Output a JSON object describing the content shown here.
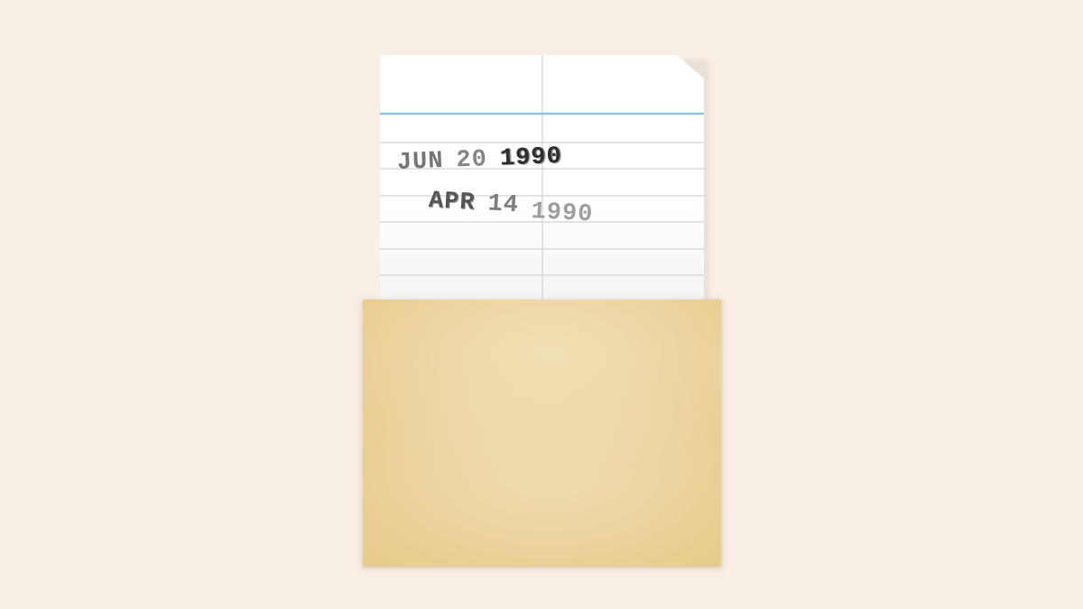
{
  "stamps": [
    {
      "month": "JUN",
      "day": "20",
      "year": "1990"
    },
    {
      "month": "APR",
      "day": "14",
      "year": "1990"
    }
  ],
  "colors": {
    "background": "#f8efe6",
    "card": "#ffffff",
    "header_rule": "#8fc1e6",
    "rule": "#d2d2d6",
    "pocket": "#ebd29c",
    "ink": "#3a3a3a"
  }
}
